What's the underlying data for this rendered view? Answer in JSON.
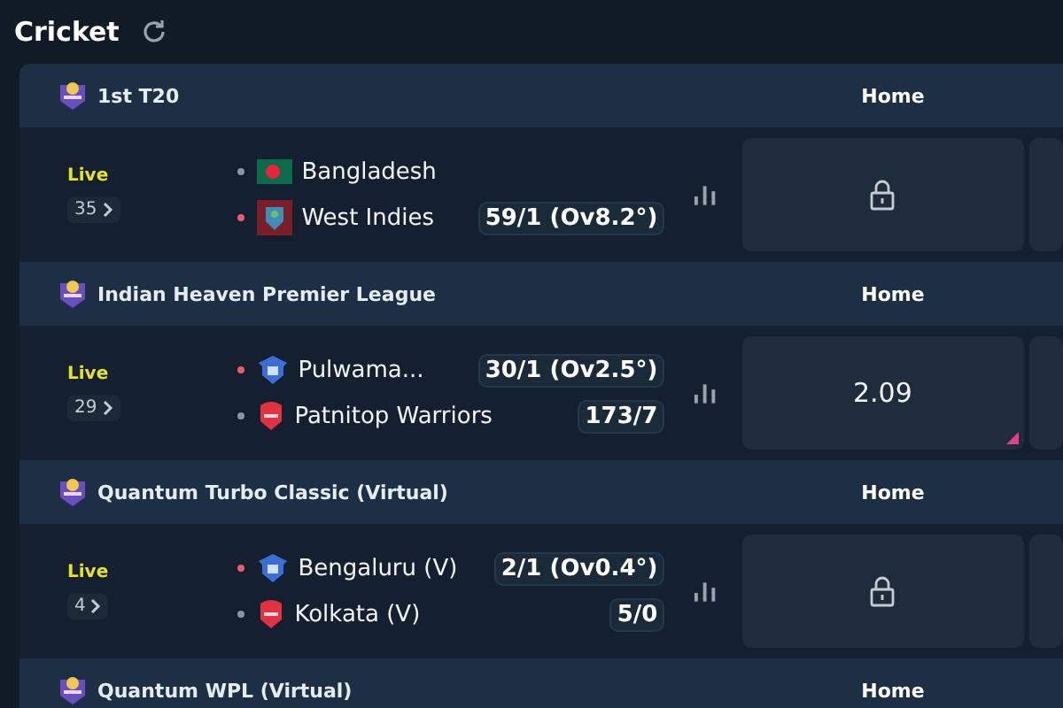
{
  "title": "Cricket",
  "sections": [
    {
      "league": "1st T20",
      "column": "Home",
      "match": {
        "status": "Live",
        "count": "35",
        "teams": [
          {
            "name": "Bangladesh",
            "kind": "bangladesh",
            "batting": false
          },
          {
            "name": "West Indies",
            "kind": "westindies",
            "batting": true,
            "score": "59/1 (Ov8.2°)"
          }
        ],
        "odds": {
          "locked": true,
          "changed": false
        }
      }
    },
    {
      "league": "Indian Heaven Premier League",
      "column": "Home",
      "match": {
        "status": "Live",
        "count": "29",
        "teams": [
          {
            "name": "Pulwama...",
            "kind": "shield-blue",
            "batting": true,
            "score": "30/1 (Ov2.5°)"
          },
          {
            "name": "Patnitop Warriors",
            "kind": "shield-red",
            "batting": false,
            "score": "173/7"
          }
        ],
        "odds": {
          "locked": false,
          "value": "2.09",
          "changed": true
        }
      }
    },
    {
      "league": "Quantum Turbo Classic (Virtual)",
      "column": "Home",
      "match": {
        "status": "Live",
        "count": "4",
        "teams": [
          {
            "name": "Bengaluru (V)",
            "kind": "shield-blue",
            "batting": true,
            "score": "2/1 (Ov0.4°)"
          },
          {
            "name": "Kolkata (V)",
            "kind": "shield-red",
            "batting": false,
            "score": "5/0"
          }
        ],
        "odds": {
          "locked": true,
          "changed": false
        }
      }
    },
    {
      "league": "Quantum WPL (Virtual)",
      "column": "Home"
    }
  ]
}
